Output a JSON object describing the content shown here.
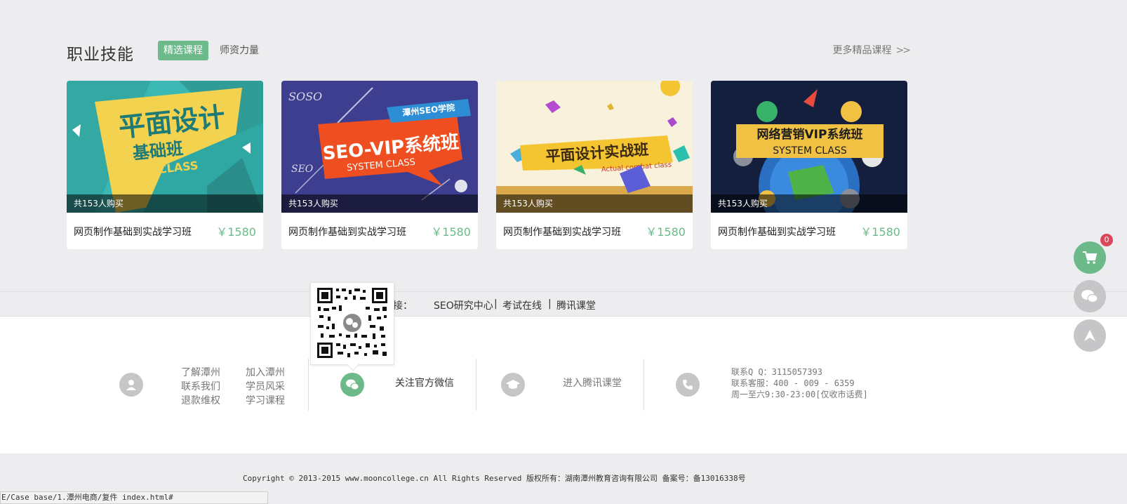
{
  "section": {
    "title": "职业技能",
    "tabs": [
      {
        "label": "精选课程",
        "active": true
      },
      {
        "label": "师资力量",
        "active": false
      }
    ],
    "more_link": "更多精品课程",
    "more_arrows": ">>"
  },
  "cards": [
    {
      "banner_main": "平面设计",
      "banner_sub": "基础班",
      "banner_en": "BASIC CLASS",
      "buyers": "共153人购买",
      "name": "网页制作基础到实战学习班",
      "price": "￥1580"
    },
    {
      "banner_tag": "潭州SEO学院",
      "banner_main": "SEO-VIP系统班",
      "banner_en": "SYSTEM CLASS",
      "banner_logo1": "SOSO",
      "banner_logo2": "SEO",
      "buyers": "共153人购买",
      "name": "网页制作基础到实战学习班",
      "price": "￥1580"
    },
    {
      "banner_main": "平面设计实战班",
      "banner_en": "Actual combat class",
      "buyers": "共153人购买",
      "name": "网页制作基础到实战学习班",
      "price": "￥1580"
    },
    {
      "banner_main": "网络营销VIP系统班",
      "banner_en": "SYSTEM CLASS",
      "buyers": "共153人购买",
      "name": "网页制作基础到实战学习班",
      "price": "￥1580"
    }
  ],
  "friend_links": {
    "label": "链接：",
    "label_full": "友情链接：",
    "items": [
      "SEO研究中心",
      "考试在线",
      "腾讯课堂"
    ],
    "separator": "|"
  },
  "footer": {
    "about_links": [
      "了解潭州",
      "加入潭州",
      "联系我们",
      "学员风采",
      "退款维权",
      "学习课程"
    ],
    "wechat": "关注官方微信",
    "tencent": "进入腾讯课堂",
    "contact_lines": [
      "联系Q Q：3115057393",
      "联系客服：400 - 009 - 6359",
      "周一至六9:30-23:00[仅收市话费]"
    ]
  },
  "copyright": "Copyright © 2013-2015 www.mooncollege.cn All Rights Reserved 版权所有：湖南潭州教育咨询有限公司 备案号：备13016338号",
  "statusbar": "E/Case base/1.潭州电商/复件 index.html#",
  "sidebar": {
    "cart_count": "0"
  },
  "colors": {
    "accent": "#6cb98a",
    "badge": "#d9475a",
    "background": "#ededef"
  }
}
